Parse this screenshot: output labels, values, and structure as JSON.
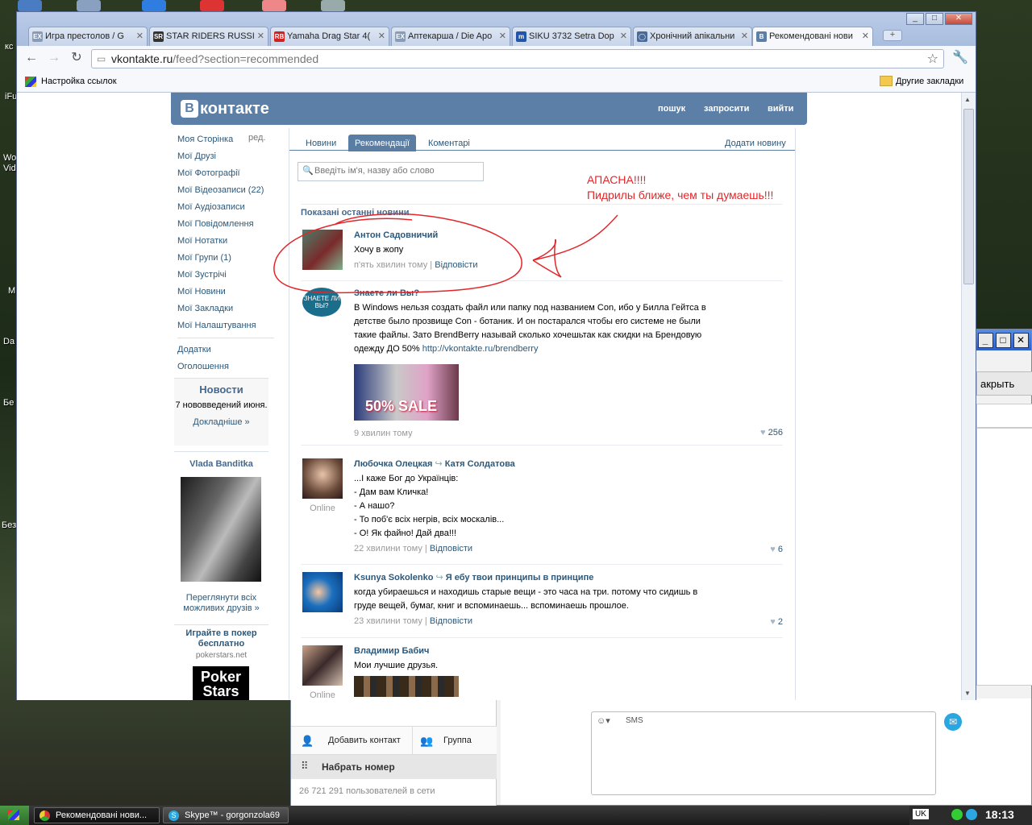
{
  "desktop": {
    "labels": [
      "кс",
      "iFu",
      "Wo",
      "Vid",
      "M",
      "Da",
      "Бе",
      "Без"
    ]
  },
  "browser": {
    "tabs": [
      {
        "label": "Игра престолов / G",
        "icon": "EX",
        "color": "#8a9bb5"
      },
      {
        "label": "STAR RIDERS RUSSI",
        "icon": "SR",
        "color": "#333"
      },
      {
        "label": "Yamaha Drag Star 4(",
        "icon": "RB",
        "color": "#d32020"
      },
      {
        "label": "Аптекарша / Die Apo",
        "icon": "EX",
        "color": "#8a9bb5"
      },
      {
        "label": "SIKU 3732 Setra Dop",
        "icon": "m",
        "color": "#2255aa"
      },
      {
        "label": "Хронічний апікальни",
        "icon": "◯",
        "color": "#4a6a9a"
      },
      {
        "label": "Рекомендовані нови",
        "icon": "B",
        "color": "#5b7fa6"
      }
    ],
    "new_tab": "+",
    "url_domain": "vkontakte.ru",
    "url_path": "/feed?section=recommended",
    "bookmark_left": "Настройка ссылок",
    "bookmark_right": "Другие закладки"
  },
  "vk": {
    "logo": "контакте",
    "logo_letter": "В",
    "header_links": [
      "пошук",
      "запросити",
      "вийти"
    ],
    "edit": "ред.",
    "nav": [
      "Моя Сторінка",
      "Мої Друзі",
      "Мої Фотографії",
      "Мої Відеозаписи (22)",
      "Мої Аудіозаписи",
      "Мої Повідомлення",
      "Мої Нотатки",
      "Мої Групи (1)",
      "Мої Зустрічі",
      "Мої Новини",
      "Мої Закладки",
      "Мої Налаштування"
    ],
    "nav2": [
      "Додатки",
      "Оголошення"
    ],
    "news_box": {
      "title": "Новости",
      "text": "7 нововведений июня.",
      "link": "Докладніше »"
    },
    "friend": {
      "name": "Vlada Banditka",
      "link": "Переглянути всіх можливих друзів »"
    },
    "ad": {
      "title": "Играйте в покер бесплатно",
      "site": "pokerstars.net",
      "logo": "Poker Stars"
    },
    "tabs": [
      "Новини",
      "Рекомендації",
      "Коментарі"
    ],
    "add_news": "Додати новину",
    "search_placeholder": "Введіть ім'я, назву або слово",
    "section_title": "Показані останні новини",
    "posts": [
      {
        "name": "Антон Садовничий",
        "text": "Хочу в жопу",
        "time": "п'ять хвилин тому",
        "reply": "Відповісти"
      },
      {
        "name": "Знаете ли Вы?",
        "text": "В Windows нельзя создать файл или папку под названием Con, ибо у Билла Гейтса в детстве было прозвище Con - ботаник. И он постарался чтобы его системе не были такие файлы. Зато BrendBerry называй сколько хочешьтак как скидки на Брендовую одежду ДО 50%",
        "link": "http://vkontakte.ru/brendberry",
        "banner": "50% SALE",
        "time": "9 хвилин тому",
        "likes": "256"
      },
      {
        "name": "Любочка Олецкая",
        "repost": "Катя Солдатова",
        "online": "Online",
        "lines": [
          "...І каже Бог до Українців:",
          "- Дам вам Кличка!",
          "- А нашо?",
          "- То поб'є всіх негрів, всіх москалів...",
          "- О! Як файно! Дай два!!!"
        ],
        "time": "22 хвилини тому",
        "reply": "Відповісти",
        "likes": "6"
      },
      {
        "name": "Ksunya Sokolenko",
        "repost": "Я ебу твои принципы в принципе",
        "text": "когда убираешься и находишь старые вещи - это часа на три. потому что сидишь в груде вещей, бумаг, книг и вспоминаешь... вспоминаешь прошлое.",
        "time": "23 хвилини тому",
        "reply": "Відповісти",
        "likes": "2"
      },
      {
        "name": "Владимир Бабич",
        "text": "Мои лучшие друзья.",
        "online": "Online"
      }
    ]
  },
  "annotation": {
    "line1": "АПАСНА!!!!",
    "line2": "Пидрилы ближе, чем ты думаешь!!!"
  },
  "skype": {
    "open_btn": "акрыть",
    "add_contact": "Добавить контакт",
    "group": "Группа",
    "dial": "Набрать номер",
    "users_online": "26 721 291 пользователей в сети",
    "sms": "SMS"
  },
  "taskbar": {
    "tasks": [
      "Рекомендовані нови...",
      "Skype™ - gorgonzola69"
    ],
    "lang": "UK",
    "clock": "18:13"
  }
}
